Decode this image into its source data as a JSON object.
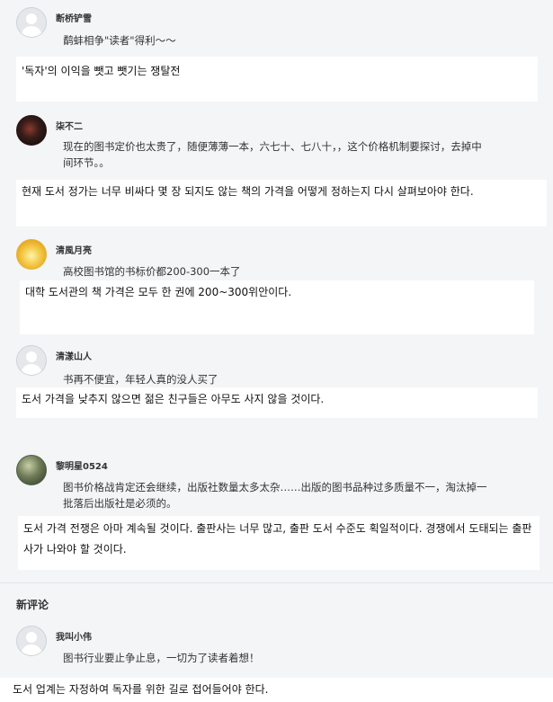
{
  "comments": [
    {
      "username": "断桥铲雪",
      "avatar_icon": "default-avatar-icon",
      "text": "鹬蚌相争\"读者\"得利～～",
      "translation": "'독자'의 이익을 뺏고 뺏기는 쟁탈전"
    },
    {
      "username": "柒不二",
      "avatar_icon": "user-photo-avatar",
      "text": "现在的图书定价也太贵了，随便薄薄一本，六七十、七八十，，这个价格机制要探讨，去掉中间环节。。",
      "translation": "현재 도서 정가는 너무 비싸다 몇 장 되지도 않는 책의 가격을 어떻게 정하는지 다시 살펴보아야 한다."
    },
    {
      "username": "清風月亮",
      "avatar_icon": "user-photo-avatar",
      "text": "高校图书馆的书标价都200-300一本了",
      "translation": "대학 도서관의 책 가격은 모두 한 권에 200~300위안이다."
    },
    {
      "username": "清漾山人",
      "avatar_icon": "default-avatar-icon",
      "text": "书再不便宜，年轻人真的没人买了",
      "translation": "도서 가격을 낮추지 않으면 젊은 친구들은 아무도 사지 않을 것이다."
    },
    {
      "username": "黎明星0524",
      "avatar_icon": "user-photo-avatar",
      "text": "图书价格战肯定还会继续，出版社数量太多太杂……出版的图书品种过多质量不一，淘汰掉一批落后出版社是必须的。",
      "translation": "도서 가격 전쟁은 아마 계속될 것이다. 출판사는 너무 많고, 출판 도서 수준도 획일적이다. 경쟁에서 도태되는 출판사가 나와야 할 것이다."
    }
  ],
  "new_comments_title": "新评论",
  "new_comments": [
    {
      "username": "我叫小伟",
      "avatar_icon": "default-avatar-icon",
      "text": "图书行业要止争止息，一切为了读者着想！",
      "translation": "도서 업계는 자정하여 독자를 위한 길로 접어들어야 한다."
    }
  ]
}
